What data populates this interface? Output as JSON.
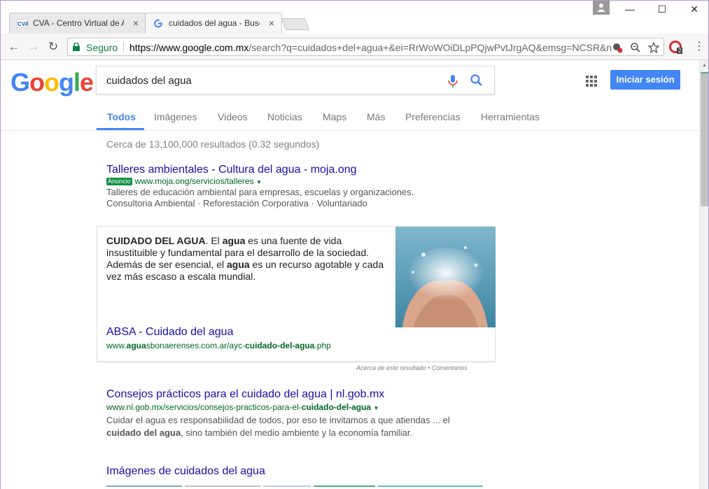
{
  "browser": {
    "tabs": [
      {
        "title": "CVA - Centro Virtual de A",
        "favicon": "cva-logo-icon"
      },
      {
        "title": "cuidados del agua - Busc",
        "favicon": "google-g-icon"
      }
    ],
    "close_glyph": "×",
    "window_controls": {
      "minimize": "—",
      "maximize": "☐",
      "close": "✕"
    },
    "secure_label": "Seguro",
    "url_host": "https://www.google.com.mx",
    "url_rest": "/search?q=cuidados+del+agua+&ei=RrWoWOiDLpPQjwPvtJrgAQ&emsg=NCSR&n",
    "extension_badge": "2"
  },
  "search": {
    "query": "cuidados del agua",
    "signin_label": "Iniciar sesión",
    "tabs": [
      "Todos",
      "Imágenes",
      "Videos",
      "Noticias",
      "Maps",
      "Más",
      "Preferencias",
      "Herramientas"
    ],
    "stats": "Cerca de 13,100,000 resultados (0.32 segundos)"
  },
  "ad_result": {
    "title": "Talleres ambientales - Cultura del agua - moja.ong",
    "badge": "Anuncio",
    "url": "www.moja.ong/servicios/talleres",
    "line1": "Talleres de educación ambiental para empresas, escuelas y organizaciones.",
    "line2": "Consultoria Ambiental · Reforestación Corporativa · Voluntariado"
  },
  "featured": {
    "p1_bold": "CUIDADO DEL AGUA",
    "p1_a": ". El ",
    "p1_b": "agua",
    "p1_c": " es una fuente de vida insustituible y fundamental para el desarrollo de la sociedad. Además de ser esencial, el ",
    "p1_d": "agua",
    "p1_e": " es un recurso agotable y cada vez más escaso a escala mundial.",
    "title": "ABSA - Cuidado del agua",
    "url_a": "www.",
    "url_b": "agua",
    "url_c": "sbonaerenses.com.ar/ayc-",
    "url_d": "cuidado-del-agua",
    "url_e": ".php",
    "about": "Acerca de este resultado • Comentarios"
  },
  "result2": {
    "title": "Consejos prácticos para el cuidado del agua | nl.gob.mx",
    "url_a": "www.nl.gob.mx/servicios/consejos-practicos-para-el-",
    "url_b": "cuidado-del-agua",
    "line1": "Cuidar el agua es responsabilidad de todos, por eso te invitamos a que atiendas ... el",
    "line2_bold": "cuidado del agua",
    "line2_rest": ", sino también del medio ambiente y la economía familiar."
  },
  "images_heading": "Imágenes de cuidados del agua",
  "colors": {
    "link": "#1a0dab",
    "url": "#006621",
    "accent": "#4285f4",
    "secure": "#0b8043"
  }
}
